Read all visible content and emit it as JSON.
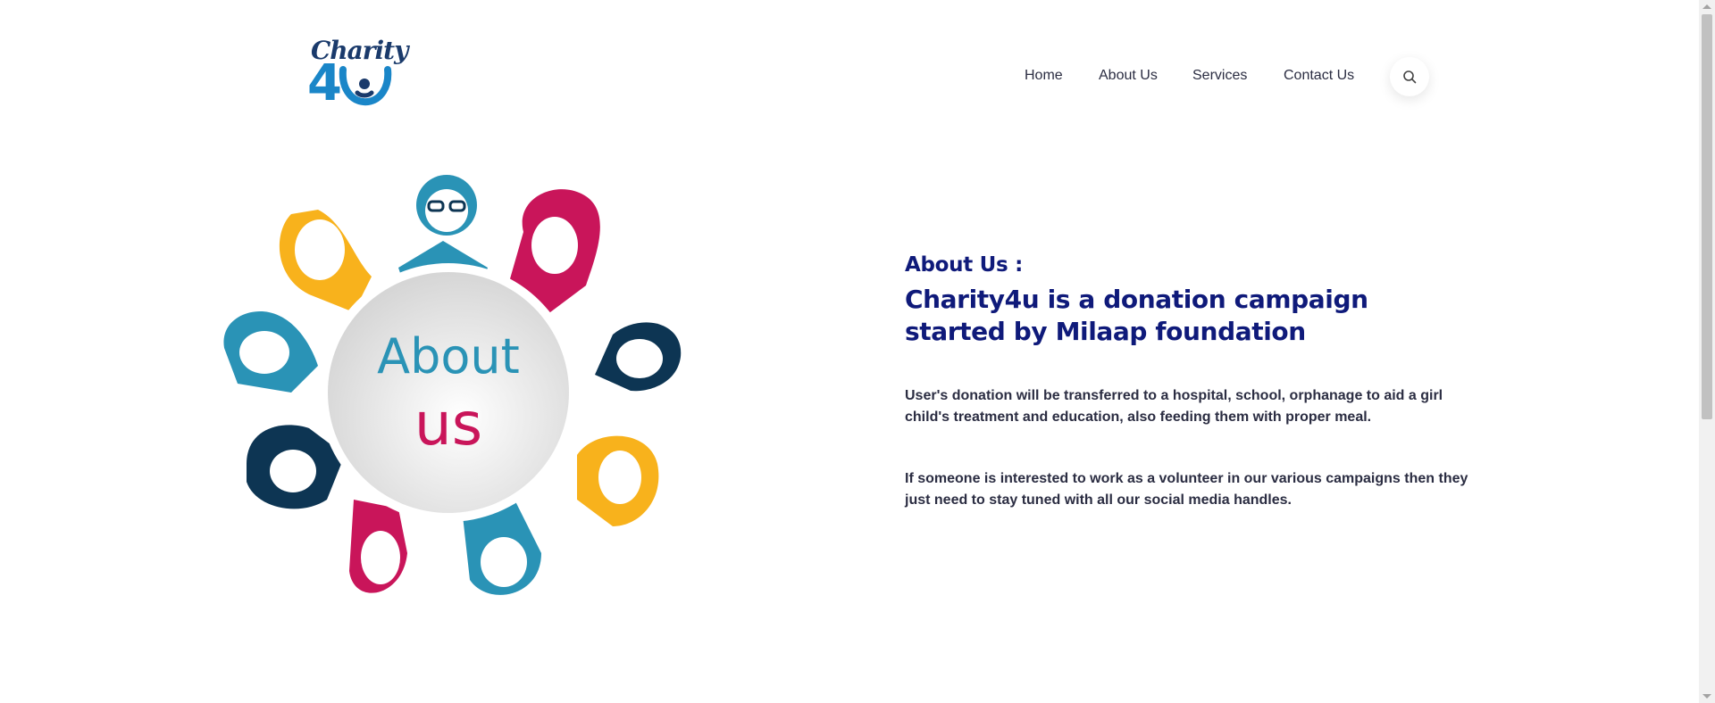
{
  "header": {
    "logo": {
      "script_text": "Charity",
      "numeral_text": "4",
      "alt": "Charity4U logo"
    },
    "nav": [
      {
        "label": "Home"
      },
      {
        "label": "About Us"
      },
      {
        "label": "Services"
      },
      {
        "label": "Contact Us"
      }
    ],
    "search_icon": "search-icon"
  },
  "illustration": {
    "word1": "About",
    "word2": "us",
    "colors": {
      "teal": "#2a93b6",
      "pink": "#c9155a",
      "yellow": "#f8b21c",
      "navy": "#0d3553"
    }
  },
  "about": {
    "eyebrow": "About Us :",
    "headline": "Charity4u is a donation campaign started by Milaap foundation",
    "para1": "User's donation will be transferred to a hospital, school, orphanage to aid a girl child's treatment and education, also feeding them with proper meal.",
    "para2": "If someone is interested to work as a volunteer in our various campaigns then they just need to stay tuned with all our social media handles."
  },
  "colors": {
    "heading": "#0f1a7a",
    "body_text": "#2b2d42",
    "brand_blue": "#1a86c8",
    "background": "#ffffff"
  }
}
